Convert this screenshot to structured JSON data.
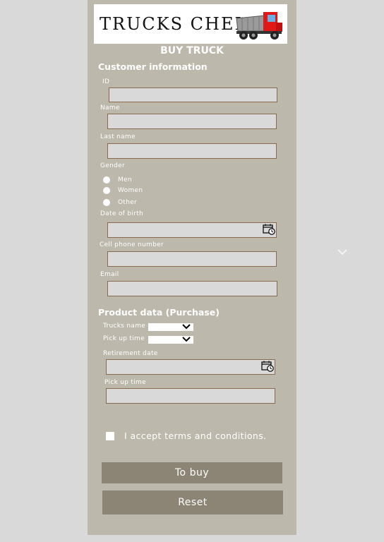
{
  "header": {
    "logo_text": "TRUCKS CHEL",
    "title": "BUY TRUCK"
  },
  "customer": {
    "heading": "Customer information",
    "id_label": "ID",
    "name_label": "Name",
    "last_name_label": "Last name",
    "gender_label": "Gender",
    "gender_options": [
      "Men",
      "Women",
      "Other"
    ],
    "dob_label": "Date of birth",
    "cell_label": "Cell phone number",
    "email_label": "Email"
  },
  "product": {
    "heading": "Product data (Purchase)",
    "trucks_name_label": "Trucks name",
    "pickup_time_label": "Pick up time",
    "retirement_label": "Retirement date",
    "pickup_time2_label": "Pick up time"
  },
  "terms": {
    "label": "I accept terms and conditions."
  },
  "buttons": {
    "buy": "To buy",
    "reset": "Reset"
  },
  "icons": {
    "logo": "dump-truck-icon",
    "date": "calendar-clock-icon",
    "dropdown": "chevron-down-icon"
  },
  "colors": {
    "panel": "#bcb8ac",
    "button": "#8c8475",
    "input_border": "#8a6a4e",
    "background": "#d9d9d9"
  }
}
